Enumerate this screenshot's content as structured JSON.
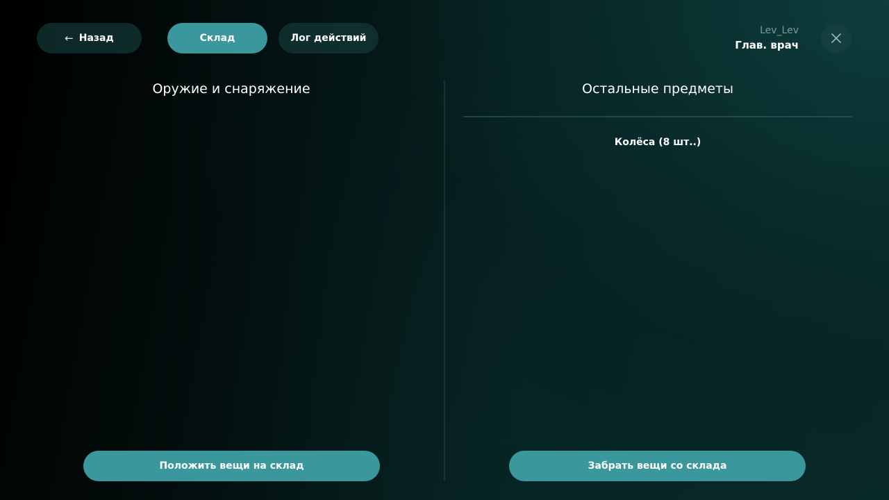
{
  "header": {
    "back_label": "Назад",
    "back_icon": "arrow-left-icon",
    "tabs": [
      {
        "label": "Склад",
        "active": true
      },
      {
        "label": "Лог действий",
        "active": false
      }
    ],
    "close_icon": "close-icon"
  },
  "user": {
    "name": "Lev_Lev",
    "role": "Глав. врач"
  },
  "columns": {
    "left": {
      "title": "Оружие и снаряжение",
      "action_label": "Положить вещи на склад"
    },
    "right": {
      "title": "Остальные предметы",
      "items": [
        {
          "label": "Колёса (8 шт..)"
        }
      ],
      "action_label": "Забрать вещи со склада"
    }
  },
  "colors": {
    "accent": "#3a979c",
    "pill_dark": "#143737",
    "muted_text": "#7f9797"
  }
}
